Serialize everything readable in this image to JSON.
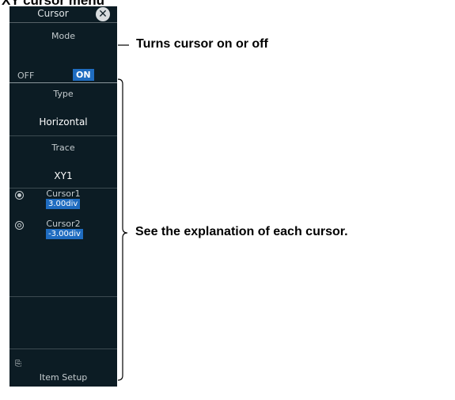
{
  "heading": "XY cursor menu",
  "menu": {
    "title": "Cursor",
    "close_icon": "close-icon",
    "mode_label": "Mode",
    "mode_off": "OFF",
    "mode_on": "ON",
    "mode_selected": "ON",
    "type_label": "Type",
    "type_value": "Horizontal",
    "trace_label": "Trace",
    "trace_value": "XY1",
    "cursors": [
      {
        "name": "Cursor1",
        "value": "3.00div",
        "indicator": "selected-radio-icon"
      },
      {
        "name": "Cursor2",
        "value": "-3.00div",
        "indicator": "radio-icon"
      }
    ],
    "item_setup_label": "Item Setup",
    "item_setup_icon": "item-setup-icon"
  },
  "callouts": {
    "mode": "Turns cursor on or off",
    "cursors": "See the explanation of each cursor."
  },
  "colors": {
    "panel_background": "#0c1c24",
    "highlight": "#1f6cc0"
  }
}
